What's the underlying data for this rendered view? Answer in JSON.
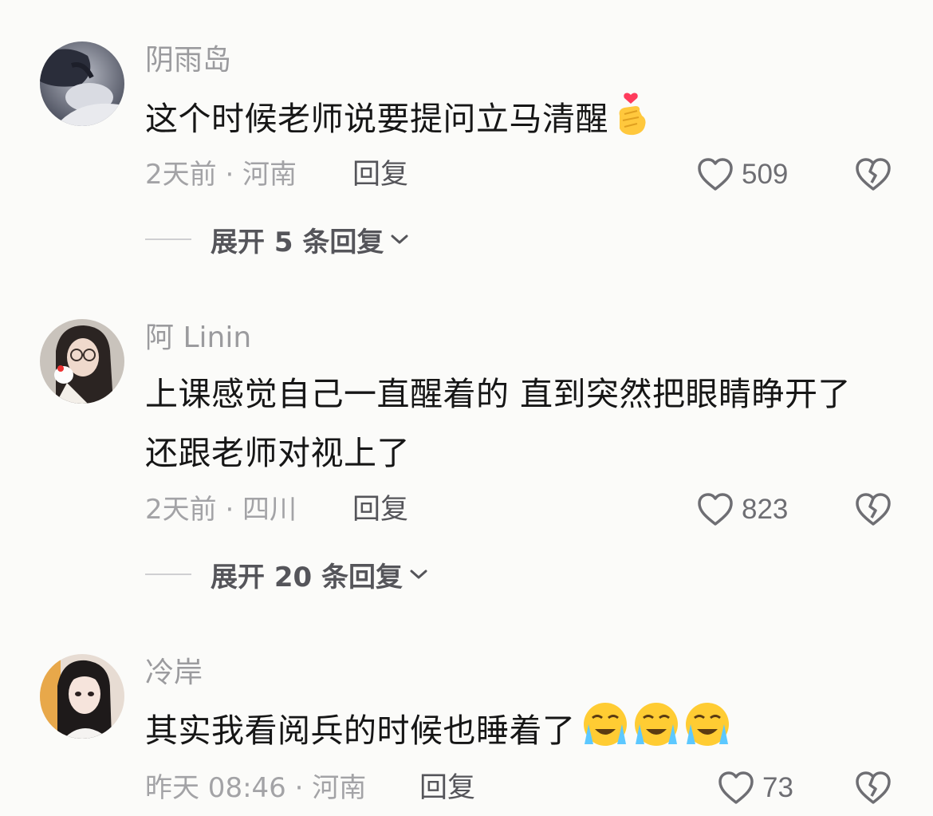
{
  "comments": [
    {
      "user": "阴雨岛",
      "text_lines": [
        "这个时候老师说要提问立马清醒"
      ],
      "emoji": "finger-heart-emoji",
      "time": "2天前 · 河南",
      "reply_label": "回复",
      "likes": "509",
      "expand_label": "展开 5 条回复"
    },
    {
      "user": "阿 Linin",
      "text_lines": [
        "上课感觉自己一直醒着的 直到突然把眼睛睁开了",
        "还跟老师对视上了"
      ],
      "time": "2天前 · 四川",
      "reply_label": "回复",
      "likes": "823",
      "expand_label": "展开 20 条回复"
    },
    {
      "user": "冷岸",
      "text_lines": [
        "其实我看阅兵的时候也睡着了"
      ],
      "emoji": "crying-face-emoji",
      "time": "昨天 08:46 · 河南",
      "reply_label": "回复",
      "likes": "73"
    }
  ],
  "icons": {
    "like": "heart-outline-icon",
    "dislike": "broken-heart-icon",
    "expand": "chevron-down-icon"
  },
  "colors": {
    "background": "#fbfbf9",
    "username": "#9b9b9e",
    "text": "#161616",
    "meta": "#a3a3a6",
    "action": "#55555a"
  }
}
